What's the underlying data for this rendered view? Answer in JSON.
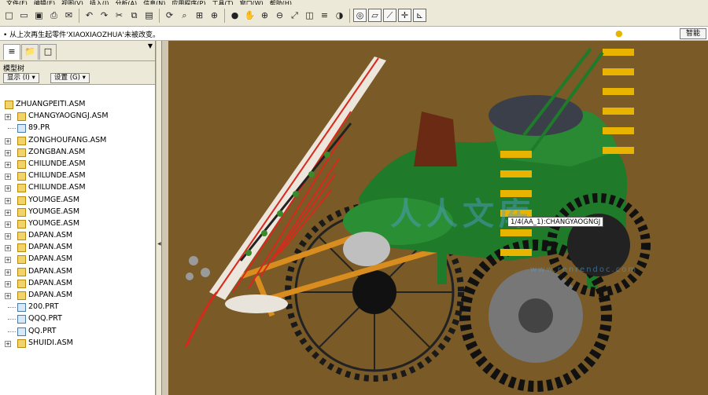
{
  "menu": {
    "items": [
      "文件(F)",
      "编辑(E)",
      "视图(V)",
      "插入(I)",
      "分析(A)",
      "信息(N)",
      "应用程序(P)",
      "工具(T)",
      "窗口(W)",
      "帮助(H)"
    ]
  },
  "toolbar": {
    "icons": [
      "new-file-icon",
      "open-file-icon",
      "save-icon",
      "print-icon",
      "email-icon",
      "undo-icon",
      "redo-icon",
      "cut-icon",
      "copy-icon",
      "paste-icon",
      "regenerate-icon",
      "find-icon",
      "datum-display-icon",
      "orient-icon",
      "shading-icon",
      "pan-icon",
      "zoom-in-icon",
      "zoom-out-icon",
      "refit-icon",
      "saved-views-icon",
      "layers-icon",
      "appearance-icon",
      "spin-center-icon",
      "datum-planes-icon",
      "datum-axes-icon",
      "datum-points-icon",
      "coordinate-systems-icon"
    ]
  },
  "message": {
    "text": "• 从上次再生起零件'XIAOXIAOZHUA'未被改变。",
    "smart_label": "智能"
  },
  "panel": {
    "header": "模型树",
    "show_btn": "显示 (I) ▾",
    "settings_btn": "设置 (G) ▾",
    "root": "ZHUANGPEITI.ASM",
    "items": [
      {
        "label": "CHANGYAOGNGJ.ASM",
        "type": "asm",
        "expandable": true
      },
      {
        "label": "89.PR",
        "type": "prt",
        "expandable": false
      },
      {
        "label": "ZONGHOUFANG.ASM",
        "type": "asm",
        "expandable": true
      },
      {
        "label": "ZONGBAN.ASM",
        "type": "asm",
        "expandable": true
      },
      {
        "label": "CHILUNDE.ASM",
        "type": "asm",
        "expandable": true
      },
      {
        "label": "CHILUNDE.ASM",
        "type": "asm",
        "expandable": true
      },
      {
        "label": "CHILUNDE.ASM",
        "type": "asm",
        "expandable": true
      },
      {
        "label": "YOUMGE.ASM",
        "type": "asm",
        "expandable": true
      },
      {
        "label": "YOUMGE.ASM",
        "type": "asm",
        "expandable": true
      },
      {
        "label": "YOUMGE.ASM",
        "type": "asm",
        "expandable": true
      },
      {
        "label": "DAPAN.ASM",
        "type": "asm",
        "expandable": true
      },
      {
        "label": "DAPAN.ASM",
        "type": "asm",
        "expandable": true
      },
      {
        "label": "DAPAN.ASM",
        "type": "asm",
        "expandable": true
      },
      {
        "label": "DAPAN.ASM",
        "type": "asm",
        "expandable": true
      },
      {
        "label": "DAPAN.ASM",
        "type": "asm",
        "expandable": true
      },
      {
        "label": "DAPAN.ASM",
        "type": "asm",
        "expandable": true
      },
      {
        "label": "200.PRT",
        "type": "prt",
        "expandable": false
      },
      {
        "label": "QQQ.PRT",
        "type": "prt",
        "expandable": false
      },
      {
        "label": "QQ.PRT",
        "type": "prt",
        "expandable": false
      },
      {
        "label": "SHUIDI.ASM",
        "type": "asm",
        "expandable": true
      }
    ]
  },
  "viewport": {
    "tooltip": "1/4(AA_1):CHANGYAOGNGJ",
    "watermark": "人人文库",
    "watermark_sub": "www.renrendoc.com",
    "colors": {
      "floor": "#7a5a26",
      "body": "#1f7a2a",
      "wheel": "#1a1a1a",
      "blade": "#d9281c",
      "tine": "#e8b400",
      "frame": "#d98d1e"
    }
  }
}
